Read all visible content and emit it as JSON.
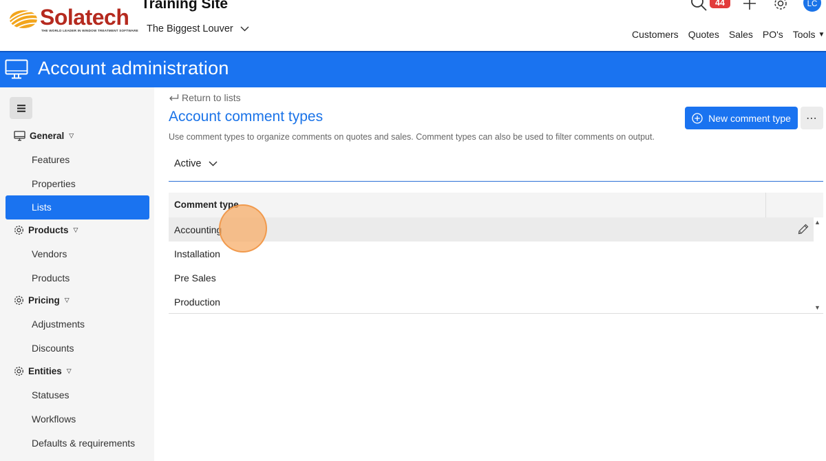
{
  "brand": {
    "logo_word": "Solatech",
    "logo_tagline": "THE WORLD LEADER IN WINDOW TREATMENT SOFTWARE",
    "accent": "#1a73f0",
    "logo_red": "#b52a1f"
  },
  "header": {
    "site_title": "Training Site",
    "site_selector": "The Biggest Louver",
    "notification_count": "44",
    "avatar_initials": "LC",
    "nav": {
      "customers": "Customers",
      "quotes": "Quotes",
      "sales": "Sales",
      "pos": "PO's",
      "tools": "Tools"
    }
  },
  "banner": {
    "title": "Account administration",
    "icon": "monitor-icon"
  },
  "sidebar": {
    "sections": {
      "general": {
        "label": "General",
        "icon": "monitor-icon",
        "items": [
          "Features",
          "Properties",
          "Lists"
        ]
      },
      "products": {
        "label": "Products",
        "icon": "gear-icon",
        "items": [
          "Vendors",
          "Products"
        ]
      },
      "pricing": {
        "label": "Pricing",
        "icon": "gear-icon",
        "items": [
          "Adjustments",
          "Discounts"
        ]
      },
      "entities": {
        "label": "Entities",
        "icon": "gear-icon",
        "items": [
          "Statuses",
          "Workflows",
          "Defaults & requirements"
        ]
      }
    },
    "active_item": "Lists"
  },
  "main": {
    "return_link": "Return to lists",
    "title": "Account comment types",
    "description": "Use comment types to organize comments on quotes and sales. Comment types can also be used to filter comments on output.",
    "new_button": "New comment type",
    "more_button": "⋯",
    "filter_value": "Active",
    "table": {
      "column_header": "Comment type",
      "rows": [
        "Accounting",
        "Installation",
        "Pre Sales",
        "Production"
      ],
      "hovered_row": "Accounting"
    }
  }
}
